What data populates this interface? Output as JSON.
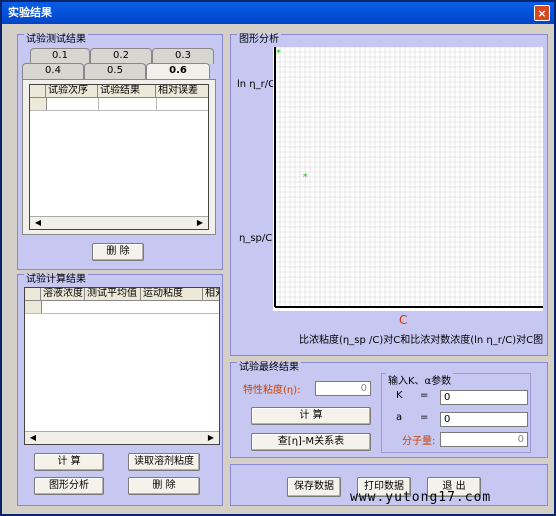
{
  "window": {
    "title": "实验结果",
    "close_glyph": "×"
  },
  "test_results": {
    "title": "试验测试结果",
    "tabs": [
      "0.1",
      "0.2",
      "0.3",
      "0.4",
      "0.5",
      "0.6"
    ],
    "active_tab": "0.6",
    "columns": [
      "试验次序",
      "试验结果",
      "相对误差"
    ],
    "delete_label": "删 除"
  },
  "calc_results": {
    "title": "试验计算结果",
    "columns": [
      "溶液浓度",
      "测试平均值",
      "运动粘度",
      "相对"
    ],
    "buttons": {
      "calc": "计 算",
      "read": "读取溶剂粘度",
      "graph": "图形分析",
      "delete": "删 除"
    }
  },
  "graph": {
    "title": "图形分析",
    "ylabel_top": "ln η_r/C",
    "ylabel_bottom": "η_sp/C",
    "xlabel": "C",
    "caption": "比浓粘度(η_sp /C)对C和比浓对数浓度(ln η_r/C)对C图",
    "point_color": "#20c020",
    "xlabel_color": "#e03000"
  },
  "chart_data": {
    "type": "scatter",
    "title": "",
    "xlabel": "C",
    "ylabel": "",
    "series": [
      {
        "name": "ln η_r/C",
        "x": [
          0.0
        ],
        "y": [
          1.0
        ]
      },
      {
        "name": "η_sp/C",
        "x": [
          0.1
        ],
        "y": [
          0.52
        ]
      }
    ],
    "xlim": [
      0,
      1
    ],
    "ylim": [
      0,
      1
    ],
    "grid": true
  },
  "final_results": {
    "title": "试验最终结果",
    "intrinsic_label": "特性粘度(η):",
    "intrinsic_value": "0",
    "calc_label": "计 算",
    "lookup_label": "查[η]-M关系表",
    "params_title": "输入K、α参数",
    "k_label": "K",
    "a_label": "a",
    "eq": "=",
    "k_value": "0",
    "a_value": "0",
    "mw_label": "分子量:",
    "mw_value": "0"
  },
  "bottom": {
    "save": "保存数据",
    "print": "打印数据",
    "exit": "退 出"
  },
  "watermark": "www.yutong17.com"
}
